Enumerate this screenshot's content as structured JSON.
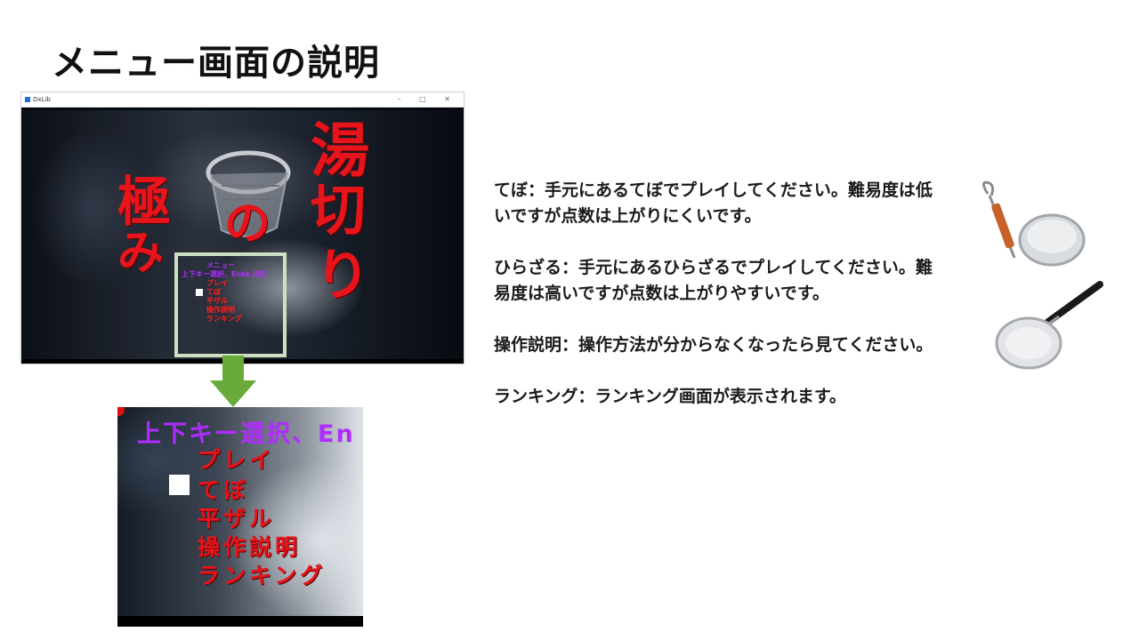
{
  "slide": {
    "title": "メニュー画面の説明"
  },
  "window": {
    "title": "DxLib",
    "controls": "– □ ✕"
  },
  "game": {
    "kanji_left": [
      "極",
      "み"
    ],
    "kanji_right": [
      "湯",
      "切",
      "り"
    ],
    "kanji_center": "の",
    "menu_header": "メニュー",
    "menu_instruction": "上下キー選択、Ente 決定",
    "menu_items": [
      "プレイ",
      "てぼ",
      "平ザル",
      "操作説明",
      "ランキング"
    ]
  },
  "zoom": {
    "header": "上下キー選択、En",
    "items": [
      "プレイ",
      "てぼ",
      "平ザル",
      "操作説明",
      "ランキング"
    ]
  },
  "descriptions": [
    "てぼ：手元にあるてぼでプレイしてください。難易度は低いですが点数は上がりにくいです。",
    "ひらざる：手元にあるひらざるでプレイしてください。難易度は高いですが点数は上がりやすいです。",
    "操作説明：操作方法が分からなくなったら見てください。",
    "ランキング：ランキング画面が表示されます。"
  ],
  "colors": {
    "menu_header": "#b02cff",
    "menu_item": "#e8141b",
    "highlight_frame": "#cde1c2",
    "arrow": "#6aaa3a"
  },
  "icons": {
    "tebo": "tebo-strainer-image",
    "hirazaru": "flat-strainer-image",
    "arrow": "down-arrow-icon"
  }
}
